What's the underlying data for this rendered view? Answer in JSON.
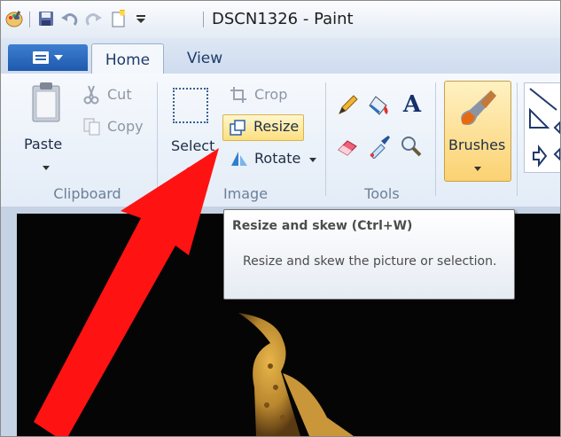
{
  "window": {
    "title": "DSCN1326 - Paint",
    "quick_access": [
      "paint-app-icon",
      "save-icon",
      "undo-icon",
      "redo-icon",
      "new-file-icon",
      "customize-dropdown-icon"
    ]
  },
  "tabs": {
    "file_menu": "menu-icon",
    "items": [
      {
        "label": "Home",
        "active": true
      },
      {
        "label": "View",
        "active": false
      }
    ]
  },
  "ribbon": {
    "clipboard": {
      "label": "Clipboard",
      "paste": "Paste",
      "cut": "Cut",
      "copy": "Copy"
    },
    "image": {
      "label": "Image",
      "select": "Select",
      "crop": "Crop",
      "resize": "Resize",
      "rotate": "Rotate"
    },
    "tools": {
      "label": "Tools",
      "items": [
        "pencil-icon",
        "fill-icon",
        "text-icon",
        "eraser-icon",
        "color-picker-icon",
        "magnifier-icon"
      ],
      "text_glyph": "A"
    },
    "brushes": {
      "label": "Brushes"
    }
  },
  "tooltip": {
    "title": "Resize and skew (Ctrl+W)",
    "description": "Resize and skew the picture or selection."
  },
  "annotation": {
    "arrow_color": "#ff1212"
  },
  "colors": {
    "accent": "#2a66b8",
    "highlight": "#fde58a",
    "tooltip_text": "#4c4c4c"
  }
}
